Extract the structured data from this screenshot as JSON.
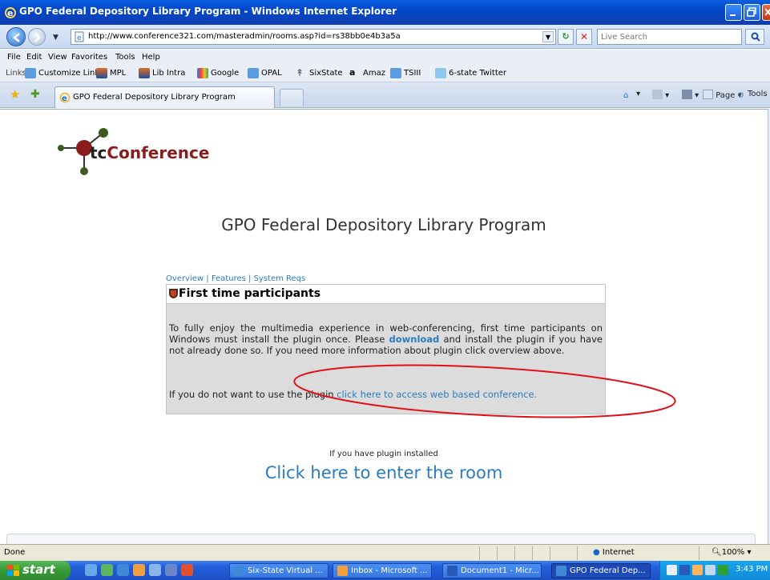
{
  "window": {
    "title": "GPO Federal Depository Library Program - Windows Internet Explorer"
  },
  "address_bar": {
    "url": "http://www.conference321.com/masteradmin/rooms.asp?id=rs38bb0e4b3a5a",
    "search_placeholder": "Live Search"
  },
  "menu": [
    "File",
    "Edit",
    "View",
    "Favorites",
    "Tools",
    "Help"
  ],
  "links_bar": {
    "label": "Links",
    "items": [
      "Customize Links",
      "MPL",
      "Lib Intra",
      "Google",
      "OPAL",
      "SixState",
      "Amaz",
      "TSIII",
      "6-state Twitter"
    ]
  },
  "tabs": {
    "active": "GPO Federal Depository Library Program"
  },
  "command_bar": {
    "page": "Page",
    "tools": "Tools"
  },
  "page": {
    "logo_tc": "tc",
    "logo_conference": "Conference",
    "title": "GPO Federal Depository Library Program",
    "nav": [
      "Overview",
      "Features",
      "System Reqs"
    ],
    "panel_heading": "First time participants",
    "panel_text_before": "To fully enjoy the multimedia experience in web-conferencing, first time participants on Windows must install the plugin once. Please ",
    "panel_download": "download",
    "panel_text_after": " and install the plugin if you have not already done so. If you need more information about plugin click overview above.",
    "no_plugin_text": "If you do not want to use the plugin ",
    "no_plugin_link": "click here to access web based conference.",
    "plugin_installed_note": "If you have plugin installed",
    "enter_room": "Click here to enter the room"
  },
  "status_bar": {
    "text": "Done",
    "zone": "Internet",
    "zoom": "100%"
  },
  "taskbar": {
    "start": "start",
    "tasks": [
      "Six-State Virtual ...",
      "Inbox - Microsoft ...",
      "Document1 - Micr...",
      "GPO Federal Dep..."
    ],
    "clock": "3:43 PM"
  },
  "colors": {
    "link_blue": "#2a7cc0",
    "brand_red": "#8b1c1c",
    "annotation_red": "#e0101a",
    "panel_gray": "#dcdcdc"
  }
}
